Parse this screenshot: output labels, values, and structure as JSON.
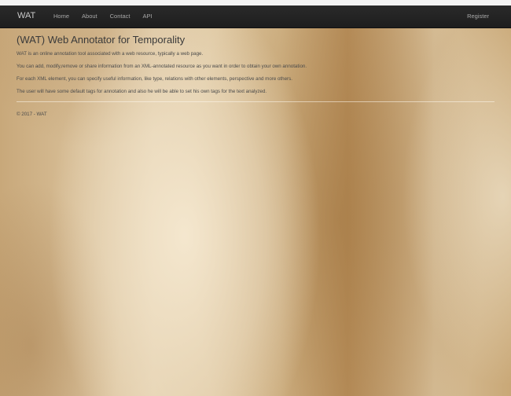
{
  "navbar": {
    "brand": "WAT",
    "links": [
      "Home",
      "About",
      "Contact",
      "API"
    ],
    "register": "Register"
  },
  "main": {
    "title": "(WAT) Web Annotator for Temporality",
    "paragraphs": [
      "WAT is an online annotation tool associated with a web resource, typically a web page.",
      "You can add, modify,remove or share information from an XML-annotated resource as you want in order to obtain your own annotation.",
      "For each XML element, you can specify useful information, like type, relations with other elements, perspective and more others.",
      "The user will have some default tags for annotation and also he will be able to set his own tags for the text analyzed."
    ]
  },
  "footer": {
    "copyright": "© 2017 - WAT"
  }
}
